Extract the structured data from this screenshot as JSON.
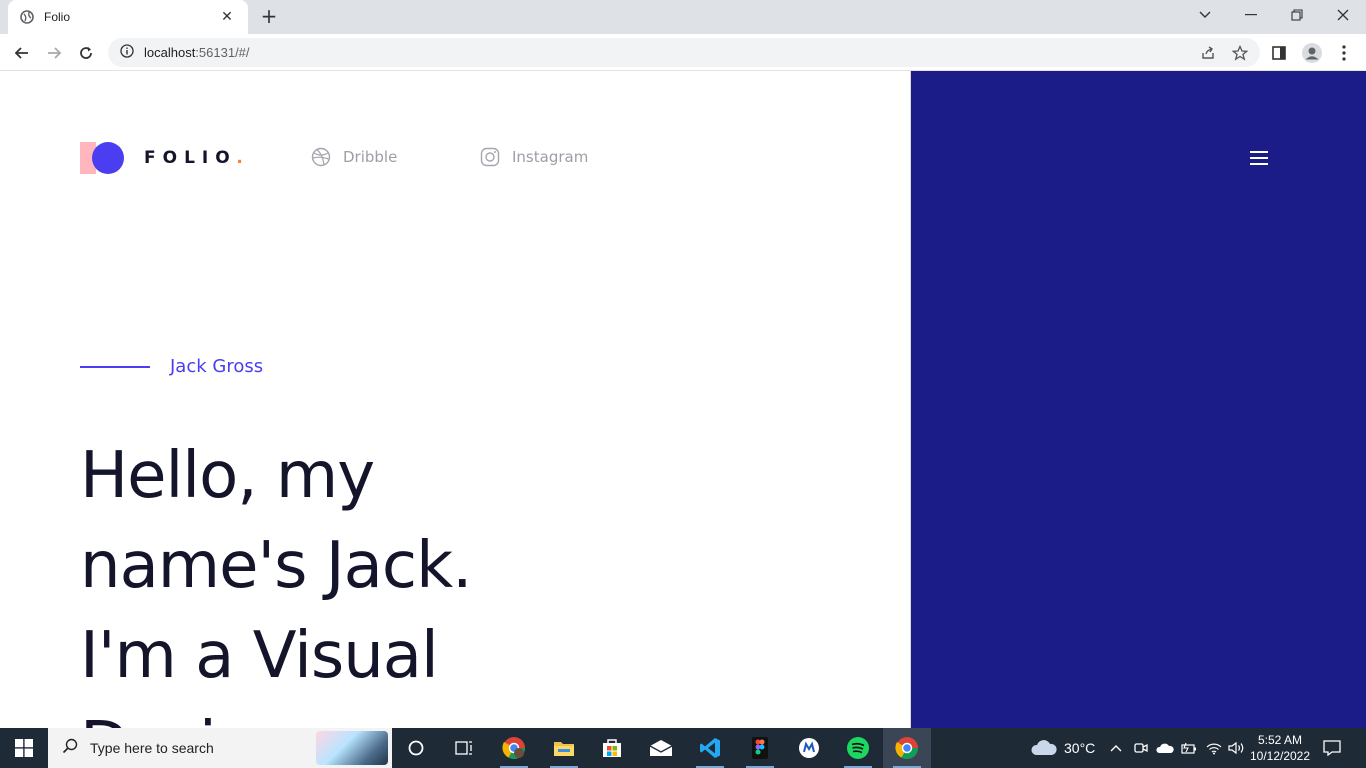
{
  "browser": {
    "tab_title": "Folio",
    "close_symbol": "✕",
    "new_tab_symbol": "+",
    "url_host": "localhost",
    "url_rest": ":56131/#/"
  },
  "site": {
    "logo_word": "FOLIO",
    "logo_dot": ".",
    "nav": [
      {
        "label": "Dribble",
        "icon": "dribbble-icon"
      },
      {
        "label": "Instagram",
        "icon": "instagram-icon"
      }
    ],
    "name": "Jack Gross",
    "hero_lines": [
      "Hello, my",
      "name's Jack.",
      "I'm a Visual",
      "Desi"
    ],
    "colors": {
      "accent": "#4a3ef0",
      "panel": "#1b1c88",
      "dot": "#ff7a32",
      "logo_square": "#ffb6bd",
      "text": "#14142b"
    }
  },
  "taskbar": {
    "search_placeholder": "Type here to search",
    "weather": "30°C",
    "time": "5:52 AM",
    "date": "10/12/2022"
  }
}
